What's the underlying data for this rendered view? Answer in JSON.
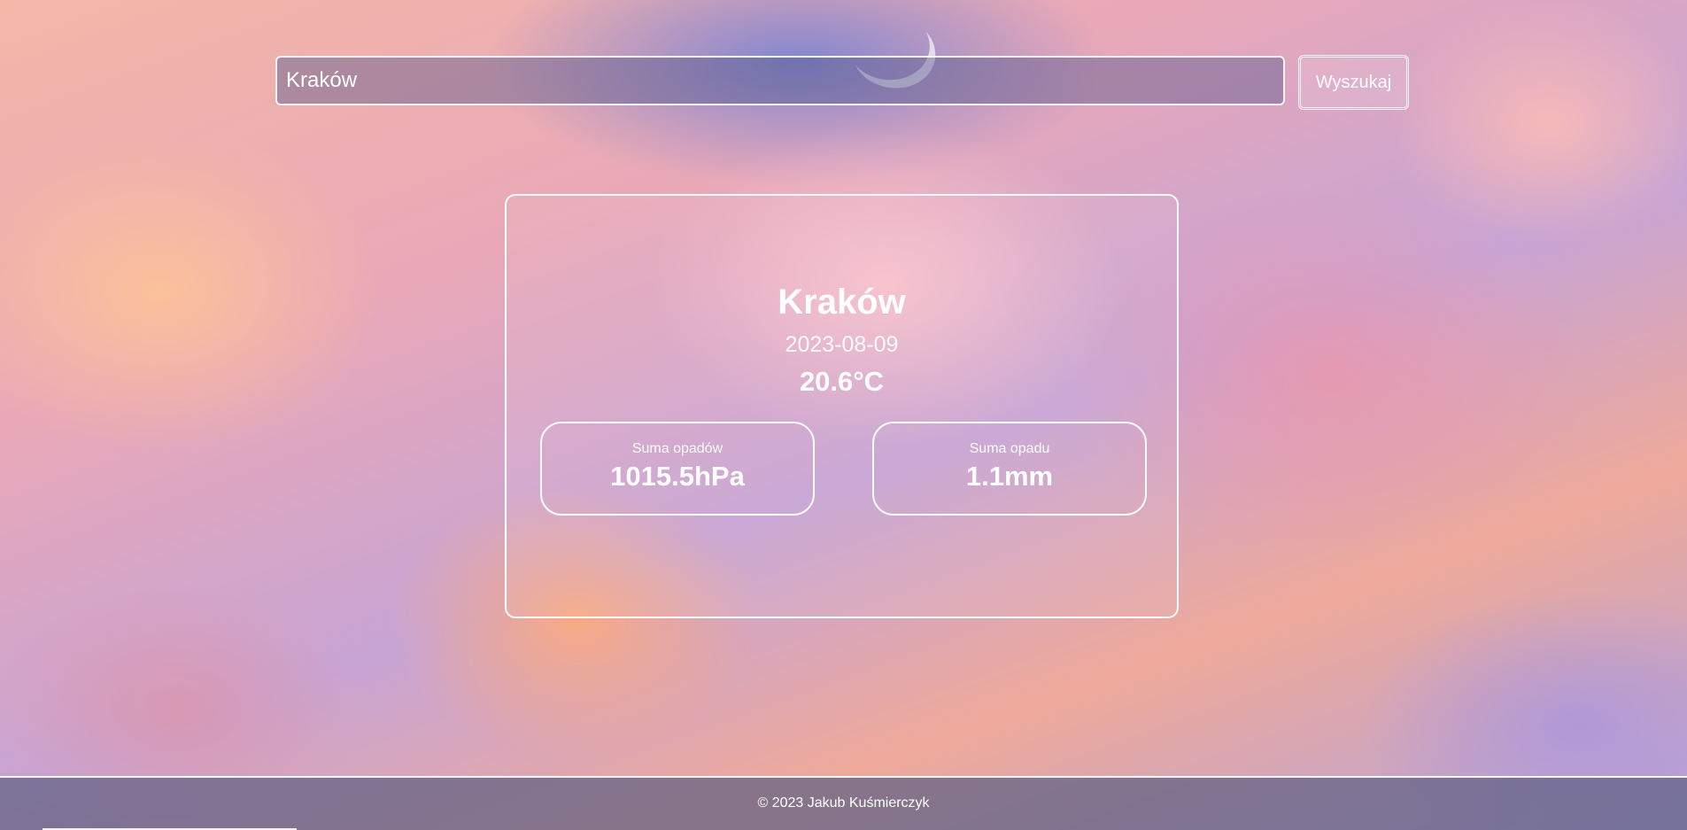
{
  "search": {
    "value": "Kraków",
    "button_label": "Wyszukaj"
  },
  "weather": {
    "city": "Kraków",
    "date": "2023-08-09",
    "temperature": "20.6°C",
    "stats": [
      {
        "label": "Suma opadów",
        "value": "1015.5hPa"
      },
      {
        "label": "Suma opadu",
        "value": "1.1mm"
      }
    ]
  },
  "footer": {
    "text": "© 2023 Jakub Kuśmierczyk"
  },
  "theme": {
    "text_color": "#ffffff",
    "border_color": "#ffffff"
  },
  "icons": {
    "moon": "crescent-moon"
  }
}
